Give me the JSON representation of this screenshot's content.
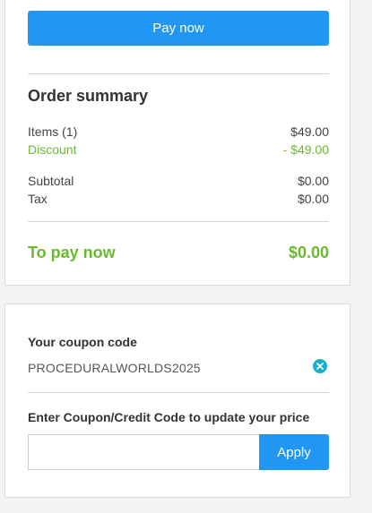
{
  "payment": {
    "pay_button_label": "Pay now"
  },
  "order_summary": {
    "title": "Order summary",
    "items": [
      {
        "label": "Items (1)",
        "value": "$49.00"
      },
      {
        "label": "Discount",
        "value": "- $49.00"
      }
    ],
    "totals": [
      {
        "label": "Subtotal",
        "value": "$0.00"
      },
      {
        "label": "Tax",
        "value": "$0.00"
      }
    ],
    "to_pay_label": "To pay now",
    "to_pay_value": "$0.00"
  },
  "coupon": {
    "label": "Your coupon code",
    "code": "PROCEDURALWORLDS2025",
    "clear_icon": "close-circle-icon",
    "enter_label": "Enter Coupon/Credit Code to update your price",
    "input_value": "",
    "input_placeholder": "",
    "apply_label": "Apply"
  },
  "colors": {
    "primary": "#2196f3",
    "accent_green": "#6aba2e",
    "clear_icon": "#16b1c6"
  }
}
